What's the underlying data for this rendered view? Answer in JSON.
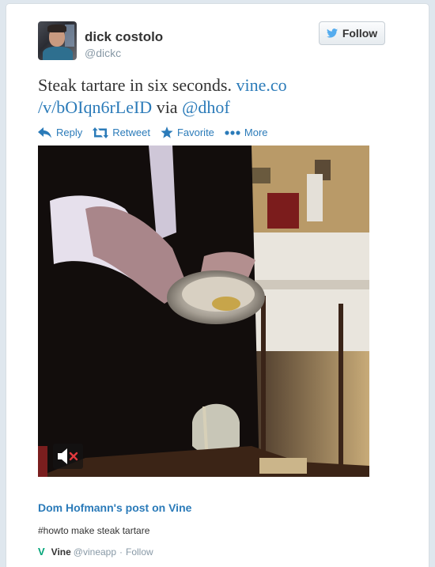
{
  "author": {
    "name": "dick costolo",
    "handle": "@dickc"
  },
  "follow_button": {
    "label": "Follow",
    "icon": "twitter-bird-icon"
  },
  "tweet": {
    "text_before": "Steak tartare in six seconds. ",
    "link_line1": "vine.co",
    "link_line2": "/v/bOIqn6rLeID",
    "text_via": " via ",
    "mention": "@dhof"
  },
  "actions": [
    {
      "label": "Reply",
      "icon": "reply-arrow-icon"
    },
    {
      "label": "Retweet",
      "icon": "retweet-icon"
    },
    {
      "label": "Favorite",
      "icon": "star-icon"
    },
    {
      "label": "More",
      "icon": "more-dots-icon"
    }
  ],
  "media": {
    "description_icon": "mute-speaker-icon"
  },
  "card": {
    "title": "Dom Hofmann's post on Vine",
    "description": "#howto make steak tartare",
    "source_name": "Vine",
    "source_handle": "@vineapp",
    "separator": "·",
    "follow_label": "Follow"
  },
  "colors": {
    "link": "#2b7bb9",
    "text": "#333333",
    "muted": "#8899a6",
    "vine_green": "#00a478",
    "background": "#dfe7ee"
  }
}
